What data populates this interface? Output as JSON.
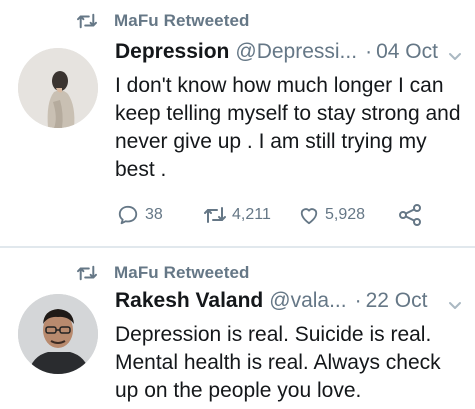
{
  "tweets": [
    {
      "retweeted_by": "MaFu Retweeted",
      "display_name": "Depression",
      "handle": "@Depressi...",
      "separator": "·",
      "date": "04 Oct",
      "text": "I don't know how much longer I can keep telling myself to stay strong and never give up . I am still trying my best .",
      "replies": "38",
      "retweets": "4,211",
      "likes": "5,928"
    },
    {
      "retweeted_by": "MaFu Retweeted",
      "display_name": "Rakesh Valand",
      "handle": "@vala...",
      "separator": "·",
      "date": "22 Oct",
      "text": "Depression is real. Suicide is real. Mental health is real. Always check up on the people you love."
    }
  ],
  "colors": {
    "secondary_text": "#657786",
    "primary_text": "#14171a",
    "divider": "#e1e8ed"
  },
  "icons": [
    "retweet-icon",
    "reply-icon",
    "like-icon",
    "share-icon",
    "chevron-down-icon"
  ]
}
